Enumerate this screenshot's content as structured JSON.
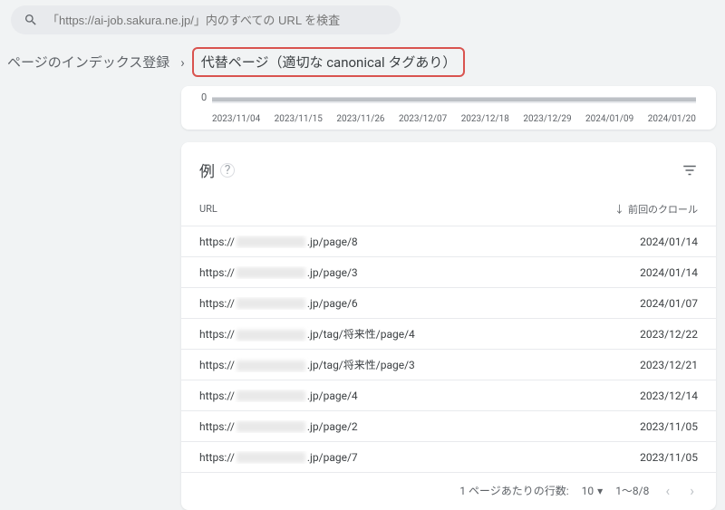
{
  "search": {
    "placeholder": "「https://ai-job.sakura.ne.jp/」内のすべての URL を検査"
  },
  "breadcrumb": {
    "parent": "ページのインデックス登録",
    "current": "代替ページ（適切な canonical タグあり）"
  },
  "chart_data": {
    "type": "area",
    "categories": [
      "2023/11/04",
      "2023/11/15",
      "2023/11/26",
      "2023/12/07",
      "2023/12/18",
      "2023/12/29",
      "2024/01/09",
      "2024/01/20"
    ],
    "values": [
      0,
      0,
      0,
      0,
      0,
      0,
      0,
      0
    ],
    "ylim": [
      0,
      10
    ],
    "y_zero_label": "0"
  },
  "examples": {
    "title": "例",
    "headers": {
      "url": "URL",
      "last_crawl": "前回のクロール"
    },
    "rows": [
      {
        "prefix": "https://",
        "suffix": ".jp/page/8",
        "date": "2024/01/14"
      },
      {
        "prefix": "https://",
        "suffix": ".jp/page/3",
        "date": "2024/01/14"
      },
      {
        "prefix": "https://",
        "suffix": ".jp/page/6",
        "date": "2024/01/07"
      },
      {
        "prefix": "https://",
        "suffix": ".jp/tag/将来性/page/4",
        "date": "2023/12/22"
      },
      {
        "prefix": "https://",
        "suffix": ".jp/tag/将来性/page/3",
        "date": "2023/12/21"
      },
      {
        "prefix": "https://",
        "suffix": ".jp/page/4",
        "date": "2023/12/14"
      },
      {
        "prefix": "https://",
        "suffix": ".jp/page/2",
        "date": "2023/11/05"
      },
      {
        "prefix": "https://",
        "suffix": ".jp/page/7",
        "date": "2023/11/05"
      }
    ]
  },
  "pager": {
    "rows_label": "1 ページあたりの行数:",
    "rows_value": "10",
    "range": "1～8/8"
  }
}
